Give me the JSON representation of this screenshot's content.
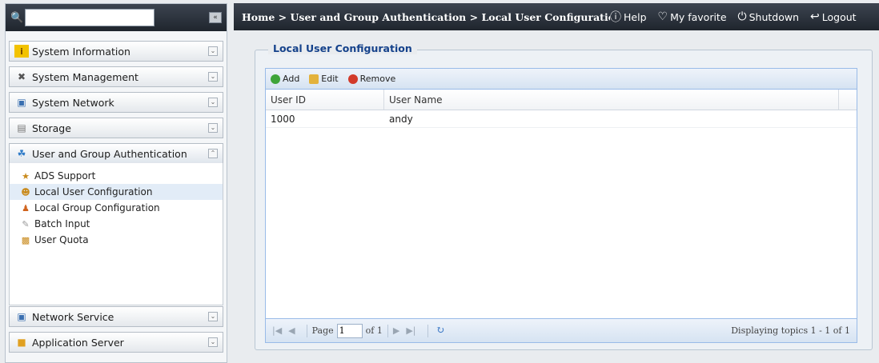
{
  "sidebar": {
    "search": {
      "value": "",
      "placeholder": ""
    },
    "menu_top": [
      {
        "label": "System Information",
        "icon": "info-icon"
      },
      {
        "label": "System Management",
        "icon": "tools-icon"
      },
      {
        "label": "System Network",
        "icon": "network-icon"
      },
      {
        "label": "Storage",
        "icon": "storage-icon"
      },
      {
        "label": "User and Group Authentication",
        "icon": "users-icon"
      }
    ],
    "submenu": [
      {
        "label": "ADS Support",
        "icon": "ads-icon"
      },
      {
        "label": "Local User Configuration",
        "icon": "local-user-icon",
        "selected": true
      },
      {
        "label": "Local Group Configuration",
        "icon": "local-group-icon"
      },
      {
        "label": "Batch Input",
        "icon": "batch-icon"
      },
      {
        "label": "User Quota",
        "icon": "quota-icon"
      }
    ],
    "menu_bottom": [
      {
        "label": "Network Service",
        "icon": "network-service-icon"
      },
      {
        "label": "Application Server",
        "icon": "app-server-icon"
      }
    ]
  },
  "header": {
    "breadcrumb": "Home > User and Group Authentication > Local User Configuration",
    "help": "Help",
    "favorite": "My favorite",
    "shutdown": "Shutdown",
    "logout": "Logout"
  },
  "main": {
    "title": "Local User Configuration",
    "toolbar": {
      "add": "Add",
      "edit": "Edit",
      "remove": "Remove"
    },
    "columns": [
      "User ID",
      "User Name"
    ],
    "rows": [
      {
        "id": "1000",
        "name": "andy"
      }
    ],
    "pager": {
      "page_label": "Page",
      "page_value": "1",
      "of_label": "of 1",
      "display": "Displaying topics 1 - 1 of 1"
    }
  },
  "colors": {
    "header_bg": "#2b323b",
    "panel_title": "#15428b",
    "grid_border": "#99bbe8"
  }
}
